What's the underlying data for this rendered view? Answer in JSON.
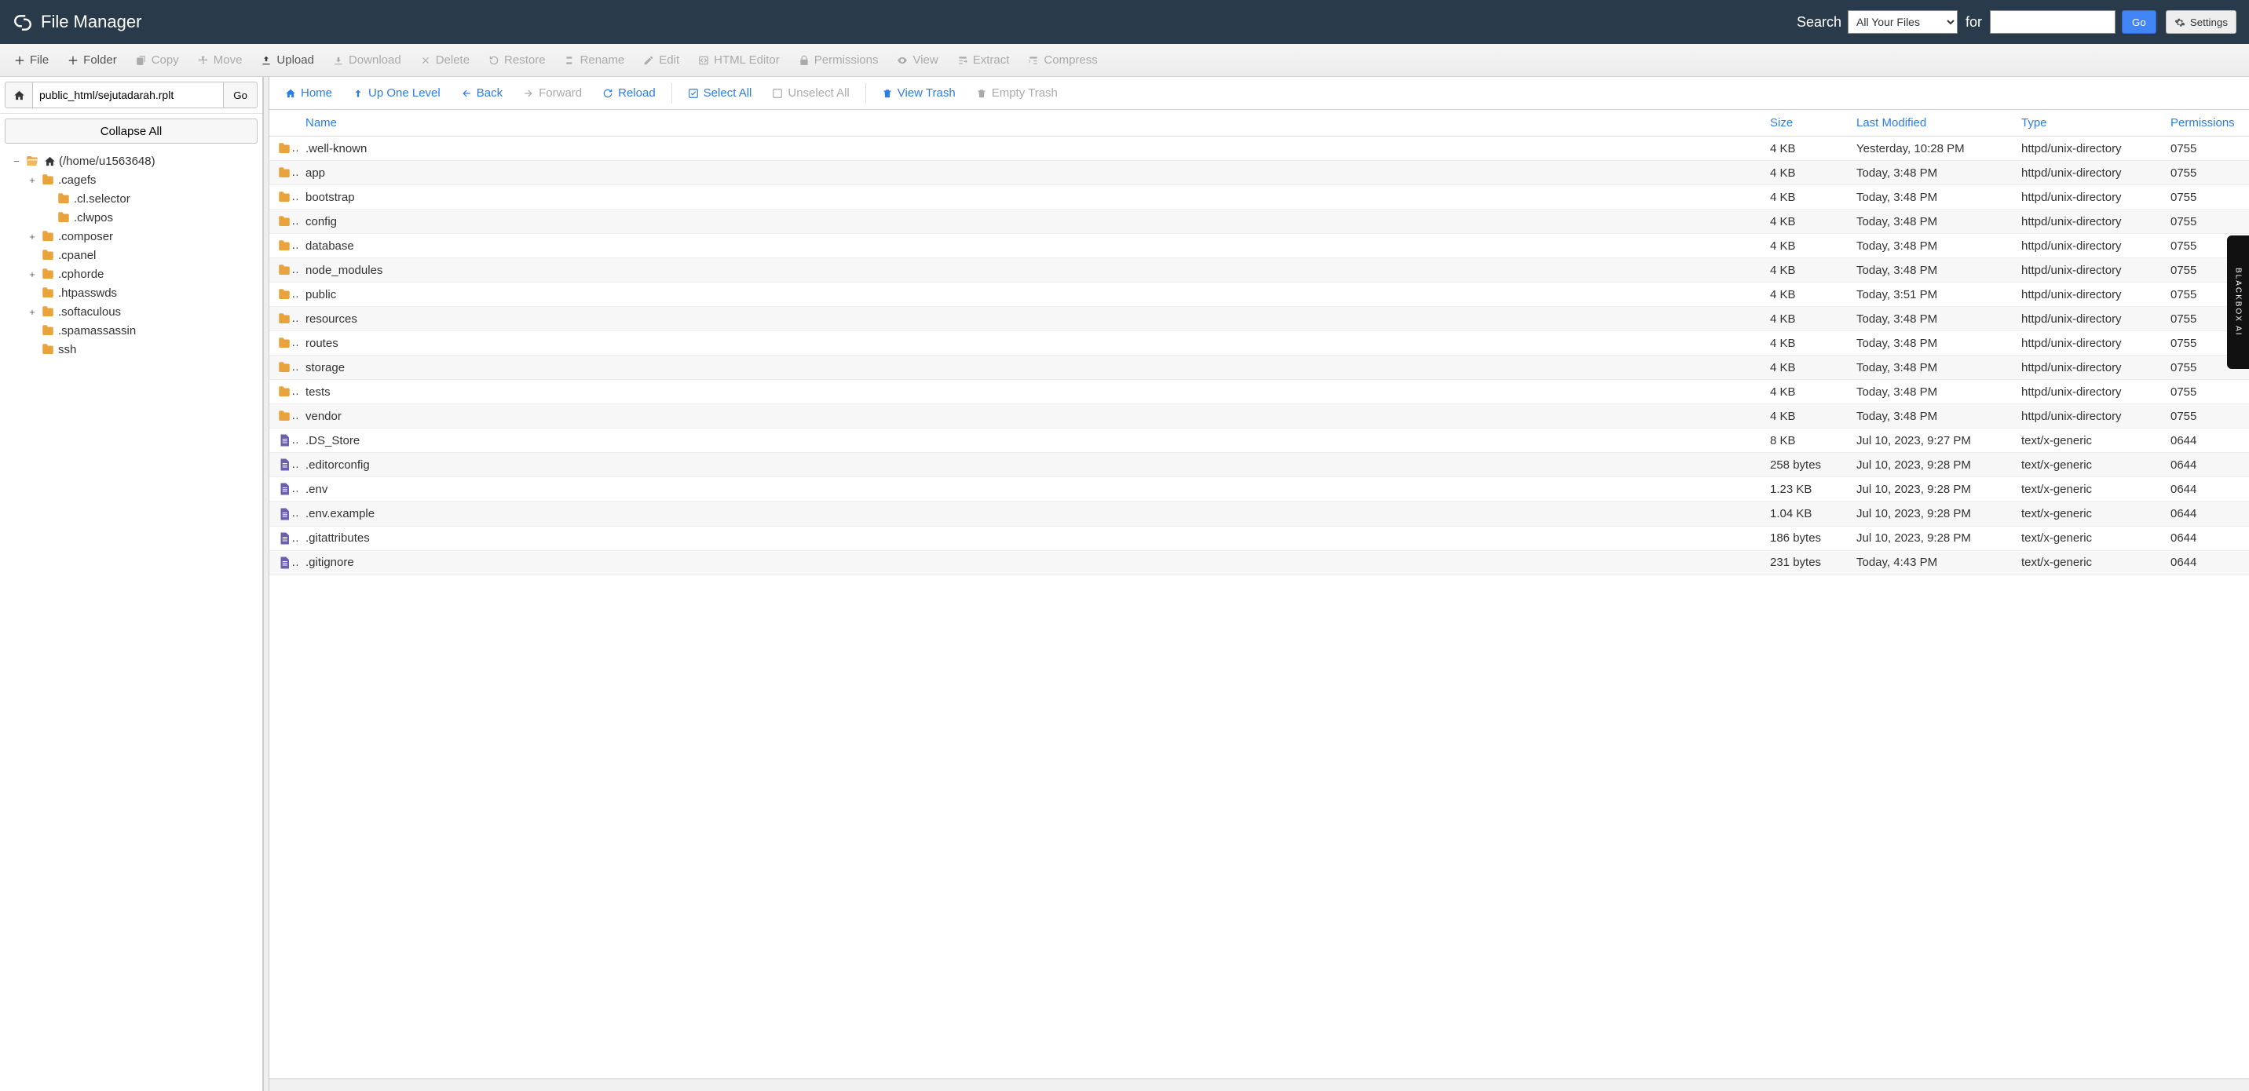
{
  "header": {
    "app_title": "File Manager",
    "search_label": "Search",
    "search_scope": "All Your Files",
    "for_label": "for",
    "search_value": "",
    "go_label": "Go",
    "settings_label": "Settings"
  },
  "toolbar": {
    "file": "File",
    "folder": "Folder",
    "copy": "Copy",
    "move": "Move",
    "upload": "Upload",
    "download": "Download",
    "delete": "Delete",
    "restore": "Restore",
    "rename": "Rename",
    "edit": "Edit",
    "html_editor": "HTML Editor",
    "permissions": "Permissions",
    "view": "View",
    "extract": "Extract",
    "compress": "Compress"
  },
  "left": {
    "path_value": "public_html/sejutadarah.rplt",
    "go_label": "Go",
    "collapse_label": "Collapse All",
    "tree": [
      {
        "depth": 0,
        "toggle": "−",
        "icon": "folder-open",
        "home": true,
        "label": "(/home/u1563648)"
      },
      {
        "depth": 1,
        "toggle": "+",
        "icon": "folder",
        "label": ".cagefs"
      },
      {
        "depth": 2,
        "toggle": "",
        "icon": "folder",
        "label": ".cl.selector"
      },
      {
        "depth": 2,
        "toggle": "",
        "icon": "folder",
        "label": ".clwpos"
      },
      {
        "depth": 1,
        "toggle": "+",
        "icon": "folder",
        "label": ".composer"
      },
      {
        "depth": 1,
        "toggle": "",
        "icon": "folder",
        "label": ".cpanel"
      },
      {
        "depth": 1,
        "toggle": "+",
        "icon": "folder",
        "label": ".cphorde"
      },
      {
        "depth": 1,
        "toggle": "",
        "icon": "folder",
        "label": ".htpasswds"
      },
      {
        "depth": 1,
        "toggle": "+",
        "icon": "folder",
        "label": ".softaculous"
      },
      {
        "depth": 1,
        "toggle": "",
        "icon": "folder",
        "label": ".spamassassin"
      },
      {
        "depth": 1,
        "toggle": "",
        "icon": "folder",
        "label": "ssh"
      }
    ]
  },
  "nav": {
    "home": "Home",
    "up": "Up One Level",
    "back": "Back",
    "forward": "Forward",
    "reload": "Reload",
    "select_all": "Select All",
    "unselect_all": "Unselect All",
    "view_trash": "View Trash",
    "empty_trash": "Empty Trash"
  },
  "table": {
    "headers": {
      "name": "Name",
      "size": "Size",
      "modified": "Last Modified",
      "type": "Type",
      "perms": "Permissions"
    },
    "rows": [
      {
        "icon": "folder",
        "name": ".well-known",
        "size": "4 KB",
        "modified": "Yesterday, 10:28 PM",
        "type": "httpd/unix-directory",
        "perms": "0755"
      },
      {
        "icon": "folder",
        "name": "app",
        "size": "4 KB",
        "modified": "Today, 3:48 PM",
        "type": "httpd/unix-directory",
        "perms": "0755"
      },
      {
        "icon": "folder",
        "name": "bootstrap",
        "size": "4 KB",
        "modified": "Today, 3:48 PM",
        "type": "httpd/unix-directory",
        "perms": "0755"
      },
      {
        "icon": "folder",
        "name": "config",
        "size": "4 KB",
        "modified": "Today, 3:48 PM",
        "type": "httpd/unix-directory",
        "perms": "0755"
      },
      {
        "icon": "folder",
        "name": "database",
        "size": "4 KB",
        "modified": "Today, 3:48 PM",
        "type": "httpd/unix-directory",
        "perms": "0755"
      },
      {
        "icon": "folder",
        "name": "node_modules",
        "size": "4 KB",
        "modified": "Today, 3:48 PM",
        "type": "httpd/unix-directory",
        "perms": "0755"
      },
      {
        "icon": "folder",
        "name": "public",
        "size": "4 KB",
        "modified": "Today, 3:51 PM",
        "type": "httpd/unix-directory",
        "perms": "0755"
      },
      {
        "icon": "folder",
        "name": "resources",
        "size": "4 KB",
        "modified": "Today, 3:48 PM",
        "type": "httpd/unix-directory",
        "perms": "0755"
      },
      {
        "icon": "folder",
        "name": "routes",
        "size": "4 KB",
        "modified": "Today, 3:48 PM",
        "type": "httpd/unix-directory",
        "perms": "0755"
      },
      {
        "icon": "folder",
        "name": "storage",
        "size": "4 KB",
        "modified": "Today, 3:48 PM",
        "type": "httpd/unix-directory",
        "perms": "0755"
      },
      {
        "icon": "folder",
        "name": "tests",
        "size": "4 KB",
        "modified": "Today, 3:48 PM",
        "type": "httpd/unix-directory",
        "perms": "0755"
      },
      {
        "icon": "folder",
        "name": "vendor",
        "size": "4 KB",
        "modified": "Today, 3:48 PM",
        "type": "httpd/unix-directory",
        "perms": "0755"
      },
      {
        "icon": "file",
        "name": ".DS_Store",
        "size": "8 KB",
        "modified": "Jul 10, 2023, 9:27 PM",
        "type": "text/x-generic",
        "perms": "0644"
      },
      {
        "icon": "file",
        "name": ".editorconfig",
        "size": "258 bytes",
        "modified": "Jul 10, 2023, 9:28 PM",
        "type": "text/x-generic",
        "perms": "0644"
      },
      {
        "icon": "file",
        "name": ".env",
        "size": "1.23 KB",
        "modified": "Jul 10, 2023, 9:28 PM",
        "type": "text/x-generic",
        "perms": "0644"
      },
      {
        "icon": "file",
        "name": ".env.example",
        "size": "1.04 KB",
        "modified": "Jul 10, 2023, 9:28 PM",
        "type": "text/x-generic",
        "perms": "0644"
      },
      {
        "icon": "file",
        "name": ".gitattributes",
        "size": "186 bytes",
        "modified": "Jul 10, 2023, 9:28 PM",
        "type": "text/x-generic",
        "perms": "0644"
      },
      {
        "icon": "file",
        "name": ".gitignore",
        "size": "231 bytes",
        "modified": "Today, 4:43 PM",
        "type": "text/x-generic",
        "perms": "0644"
      }
    ]
  },
  "blackbox_label": "BLACKBOX AI"
}
